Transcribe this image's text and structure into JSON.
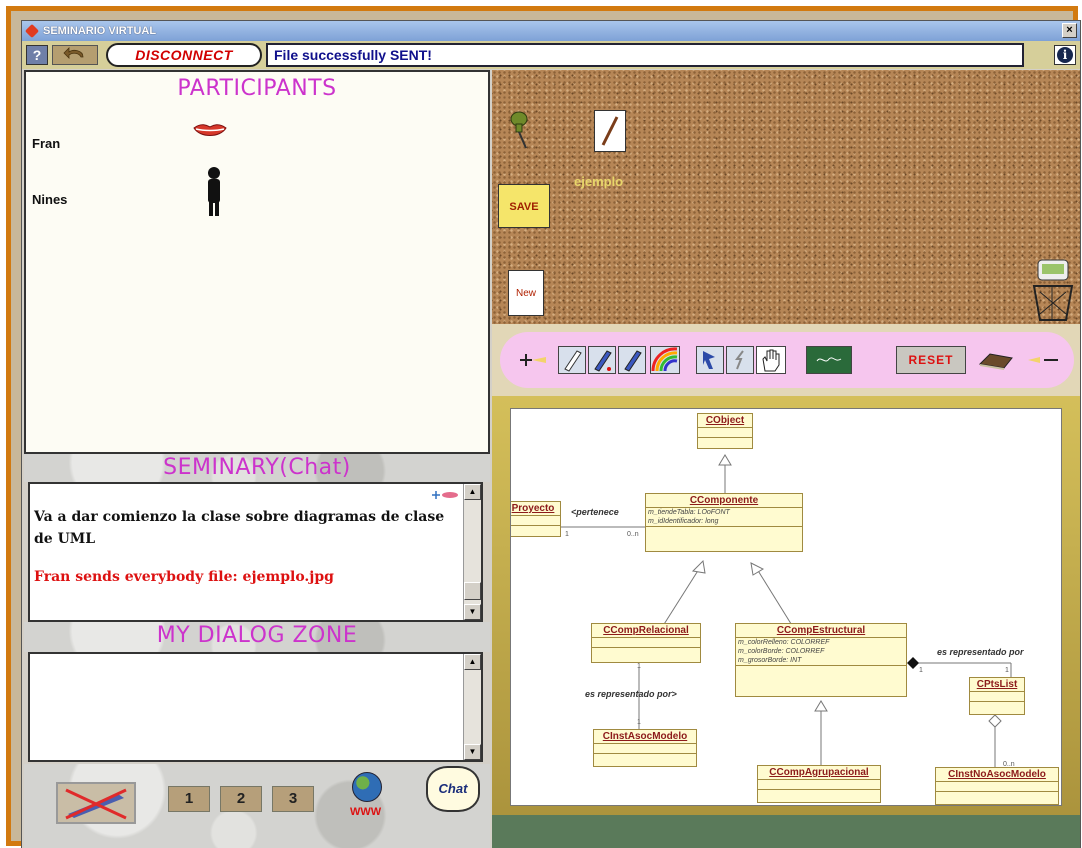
{
  "window": {
    "title": "SEMINARIO VIRTUAL",
    "close_glyph": "×"
  },
  "toolbar": {
    "help_glyph": "?",
    "disconnect_label": "DISCONNECT",
    "status_text": "File successfully SENT!",
    "info_glyph": "i"
  },
  "participants": {
    "heading": "PARTICIPANTS",
    "list": [
      {
        "name": "Fran",
        "icon": "lips-icon"
      },
      {
        "name": "Nines",
        "icon": "person-silhouette-icon"
      }
    ]
  },
  "chat": {
    "heading": "SEMINARY(Chat)",
    "messages": [
      {
        "text": "Va a dar comienzo la clase sobre diagramas de clase de UML",
        "color": "#111111"
      },
      {
        "text": "Fran sends everybody file: ejemplo.jpg",
        "color": "#dd1111"
      }
    ]
  },
  "dialog": {
    "heading": "MY DIALOG ZONE",
    "value": ""
  },
  "bottom_bar": {
    "pages": [
      "1",
      "2",
      "3"
    ],
    "www_label": "WWW",
    "chat_label": "Chat"
  },
  "corkboard": {
    "file_label": "ejemplo",
    "save_label": "SAVE",
    "new_label": "New"
  },
  "tools": {
    "reset_label": "RESET",
    "icons": [
      "zoom-in-icon",
      "pencil-icon",
      "pen-red-icon",
      "pen-blue-icon",
      "color-palette-icon",
      "pointer-icon",
      "pointer-grey-icon",
      "hand-icon",
      "blackboard-icon",
      "eraser-icon",
      "zoom-out-icon"
    ]
  },
  "uml": {
    "classes": {
      "cobject": "CObject",
      "proyecto": "Proyecto",
      "ccomponente": "CComponente",
      "ccomponente_attrs": [
        "m_tiendeTabla: LOoFONT",
        "m_idIdentificador: long"
      ],
      "crelacional": "CCompRelacional",
      "cestructural": "CCompEstructural",
      "cestructural_attrs": [
        "m_colorRelleno: COLORREF",
        "m_colorBorde: COLORREF",
        "m_grosorBorde: INT"
      ],
      "cptslist": "CPtsList",
      "cinstasoc": "CInstAsocModelo",
      "cagrupacional": "CCompAgrupacional",
      "cinstno": "CInstNoAsocModelo"
    },
    "associations": {
      "pertenece": "<pertenece",
      "representado1": "es representado por>",
      "representado2": "es representado por"
    },
    "multiplicities": [
      "1",
      "0..n",
      "1",
      "1",
      "1",
      "1",
      "0..n"
    ]
  }
}
